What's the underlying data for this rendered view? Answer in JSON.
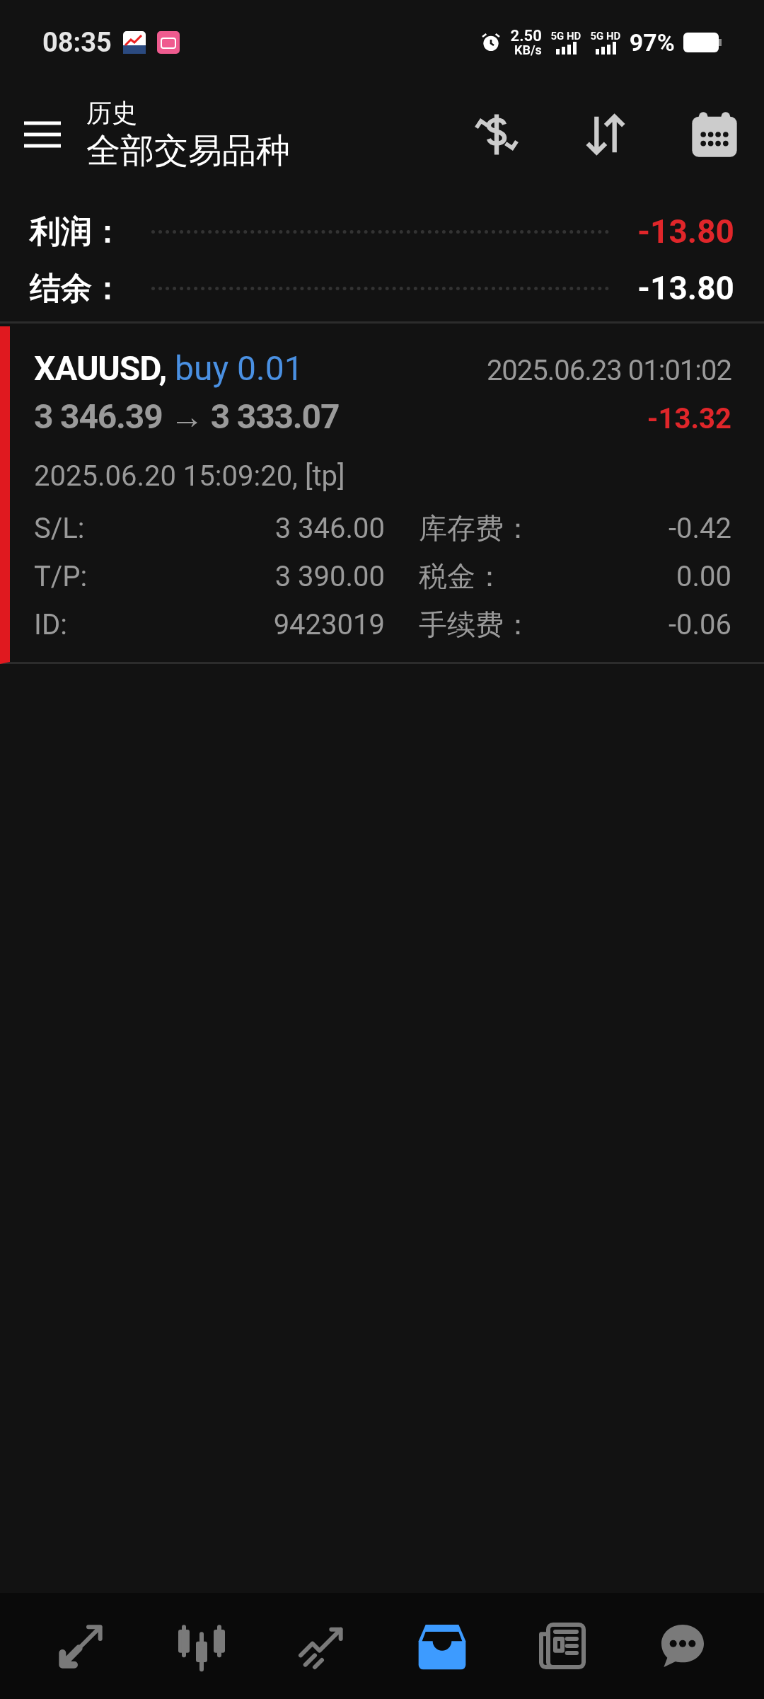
{
  "status_bar": {
    "time": "08:35",
    "net_speed": "2.50",
    "net_unit": "KB/s",
    "sims": [
      "5G HD",
      "5G HD"
    ],
    "battery": "97%"
  },
  "header": {
    "subtitle": "历史",
    "title": "全部交易品种"
  },
  "summary": [
    {
      "label": "利润：",
      "value": "-13.80",
      "color": "#e0262a"
    },
    {
      "label": "结余：",
      "value": "-13.80",
      "color": "#ffffff"
    }
  ],
  "deal": {
    "symbol": "XAUUSD,",
    "side": "buy 0.01",
    "close_time": "2025.06.23 01:01:02",
    "prices": "3 346.39 → 3 333.07",
    "profit": "-13.32",
    "open_info": "2025.06.20 15:09:20, [tp]",
    "details": [
      {
        "label": "S/L:",
        "value": "3 346.00",
        "label2": "库存费：",
        "value2": "-0.42"
      },
      {
        "label": "T/P:",
        "value": "3 390.00",
        "label2": "税金：",
        "value2": "0.00"
      },
      {
        "label": "ID:",
        "value": "9423019",
        "label2": "手续费：",
        "value2": "-0.06"
      }
    ]
  },
  "nav": [
    {
      "kind": "trade",
      "selected": false
    },
    {
      "kind": "quotes",
      "selected": false
    },
    {
      "kind": "chart",
      "selected": false
    },
    {
      "kind": "history",
      "selected": true
    },
    {
      "kind": "news",
      "selected": false
    },
    {
      "kind": "chat",
      "selected": false
    }
  ]
}
